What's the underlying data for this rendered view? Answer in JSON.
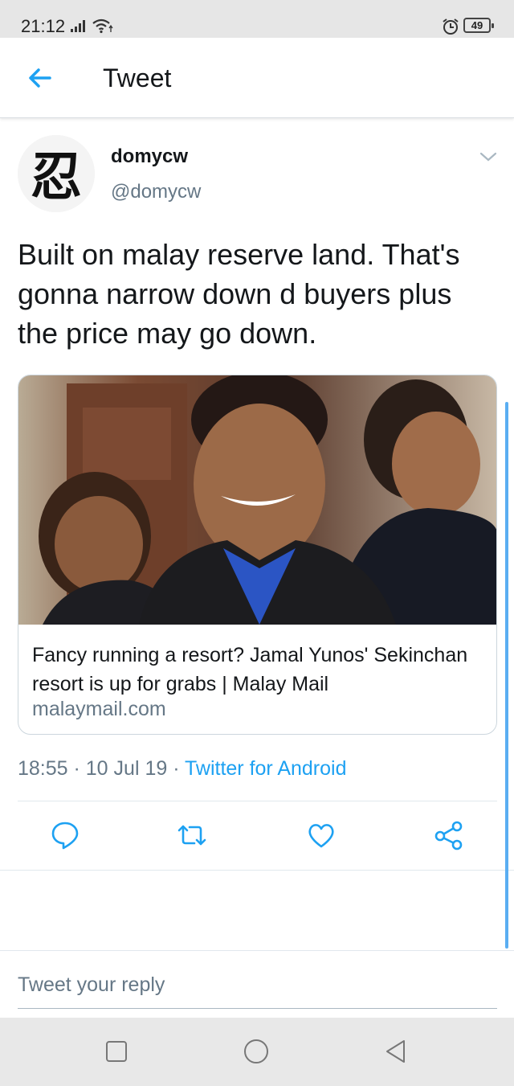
{
  "status_bar": {
    "time": "21:12",
    "battery": "49",
    "icons": [
      "signal-icon",
      "wifi-icon",
      "alarm-icon",
      "battery-icon"
    ]
  },
  "header": {
    "back_icon": "arrow-left-icon",
    "title": "Tweet"
  },
  "tweet": {
    "author": {
      "display_name": "domycw",
      "handle": "@domycw",
      "avatar_glyph": "忍"
    },
    "text": "Built on malay reserve land. That's gonna narrow down d buyers plus the price may go down.",
    "card": {
      "title": "Fancy running a resort? Jamal Yunos' Sekinchan resort is up for grabs | Malay Mail",
      "domain": "malaymail.com",
      "image": "photo-of-smiling-man-in-suit-with-two-men"
    },
    "time": "18:55",
    "date": "10 Jul 19",
    "source": "Twitter for Android",
    "actions": [
      "reply-icon",
      "retweet-icon",
      "like-icon",
      "share-icon"
    ]
  },
  "reply": {
    "placeholder": "Tweet your reply"
  },
  "navigation": {
    "buttons": [
      "recent-apps-icon",
      "home-icon",
      "back-icon"
    ]
  },
  "colors": {
    "accent": "#1da1f2",
    "secondary_text": "#657786",
    "primary_text": "#14171a",
    "divider": "#e1e8ed"
  }
}
